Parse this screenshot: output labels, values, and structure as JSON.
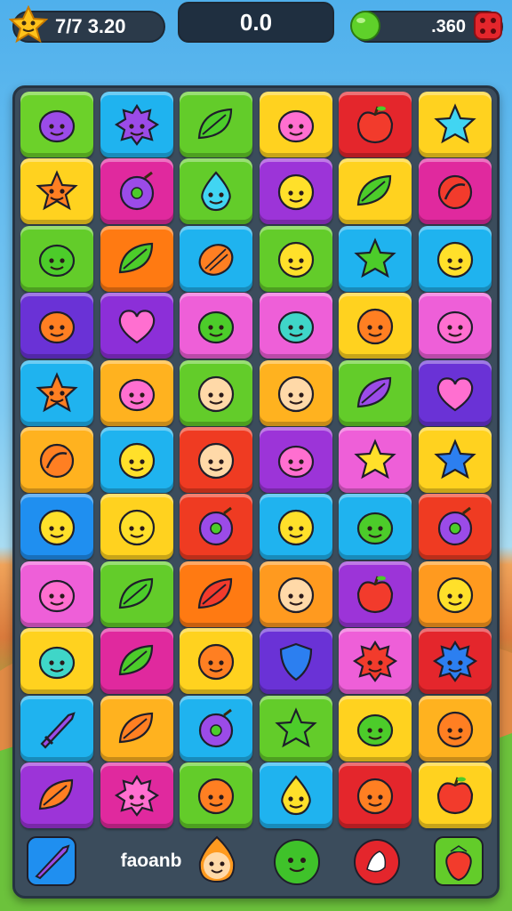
{
  "hud": {
    "left_value": "7/7 3.20",
    "center_value": "0.0",
    "right_value": ".360",
    "left_icon": "star-badge-icon",
    "right_icon_left": "green-orb-icon",
    "right_icon_right": "red-dice-icon"
  },
  "board": {
    "rows": [
      [
        {
          "c": "#6cd12a",
          "i": "blob-purple"
        },
        {
          "c": "#1fb3ef",
          "i": "spiky-purple"
        },
        {
          "c": "#63cc2a",
          "i": "leaf-green"
        },
        {
          "c": "#ffd21f",
          "i": "blob-pink"
        },
        {
          "c": "#e4262c",
          "i": "apple-red"
        },
        {
          "c": "#ffd21f",
          "i": "star-cyan"
        }
      ],
      [
        {
          "c": "#ffd21f",
          "i": "star-orange"
        },
        {
          "c": "#e0299e",
          "i": "plum-purple"
        },
        {
          "c": "#63cc2a",
          "i": "drop-cyan"
        },
        {
          "c": "#9c34d8",
          "i": "face-yellow"
        },
        {
          "c": "#ffd21f",
          "i": "leaf-green"
        },
        {
          "c": "#e0299e",
          "i": "swirl-red"
        }
      ],
      [
        {
          "c": "#63cc2a",
          "i": "blob-green"
        },
        {
          "c": "#ff7a12",
          "i": "leaf-green"
        },
        {
          "c": "#1fb3ef",
          "i": "shell-orange"
        },
        {
          "c": "#63cc2a",
          "i": "face-yellow"
        },
        {
          "c": "#1fb3ef",
          "i": "star-green"
        },
        {
          "c": "#1fb3ef",
          "i": "face-yellow"
        }
      ],
      [
        {
          "c": "#6a32d6",
          "i": "blob-orange"
        },
        {
          "c": "#8c2fd8",
          "i": "heart-pink"
        },
        {
          "c": "#ee5fd8",
          "i": "blob-green"
        },
        {
          "c": "#ee5fd8",
          "i": "blob-teal"
        },
        {
          "c": "#ffd21f",
          "i": "face-orange"
        },
        {
          "c": "#ee5fd8",
          "i": "blob-pink"
        }
      ],
      [
        {
          "c": "#1fb3ef",
          "i": "star-orange"
        },
        {
          "c": "#ffb21f",
          "i": "blob-pink"
        },
        {
          "c": "#63cc2a",
          "i": "face-peach"
        },
        {
          "c": "#ffb21f",
          "i": "face-peach"
        },
        {
          "c": "#63cc2a",
          "i": "leaf-purple"
        },
        {
          "c": "#6a32d6",
          "i": "heart-pink"
        }
      ],
      [
        {
          "c": "#ffb21f",
          "i": "swirl-orange"
        },
        {
          "c": "#1fb3ef",
          "i": "face-yellow"
        },
        {
          "c": "#ef3b22",
          "i": "face-peach"
        },
        {
          "c": "#9c34d8",
          "i": "blob-pink"
        },
        {
          "c": "#ee5fd8",
          "i": "star-yellow"
        },
        {
          "c": "#ffd21f",
          "i": "star-blue"
        }
      ],
      [
        {
          "c": "#1f8ff0",
          "i": "face-yellow"
        },
        {
          "c": "#ffd21f",
          "i": "face-yellow"
        },
        {
          "c": "#ef3b22",
          "i": "plum-purple"
        },
        {
          "c": "#1fb3ef",
          "i": "face-yellow"
        },
        {
          "c": "#1fb3ef",
          "i": "blob-green"
        },
        {
          "c": "#ef3b22",
          "i": "plum-purple"
        }
      ],
      [
        {
          "c": "#ee5fd8",
          "i": "blob-pink"
        },
        {
          "c": "#63cc2a",
          "i": "leaf-green"
        },
        {
          "c": "#ff7a12",
          "i": "leaf-red"
        },
        {
          "c": "#ff9a1f",
          "i": "face-peach"
        },
        {
          "c": "#9c34d8",
          "i": "apple-red"
        },
        {
          "c": "#ff9a1f",
          "i": "face-yellow"
        }
      ],
      [
        {
          "c": "#ffd21f",
          "i": "blob-teal"
        },
        {
          "c": "#e0299e",
          "i": "leaf-green"
        },
        {
          "c": "#ffd21f",
          "i": "face-orange"
        },
        {
          "c": "#6a32d6",
          "i": "shield-blue"
        },
        {
          "c": "#ee5fd8",
          "i": "spiky-red"
        },
        {
          "c": "#e4262c",
          "i": "spiky-blue"
        }
      ],
      [
        {
          "c": "#1fb3ef",
          "i": "sword-purple"
        },
        {
          "c": "#ffb21f",
          "i": "leaf-orange"
        },
        {
          "c": "#1fb3ef",
          "i": "plum-purple"
        },
        {
          "c": "#63cc2a",
          "i": "star-green"
        },
        {
          "c": "#ffd21f",
          "i": "blob-green"
        },
        {
          "c": "#ffb21f",
          "i": "face-orange"
        }
      ],
      [
        {
          "c": "#9c34d8",
          "i": "leaf-orange"
        },
        {
          "c": "#e0299e",
          "i": "spiky-pink"
        },
        {
          "c": "#63cc2a",
          "i": "face-orange"
        },
        {
          "c": "#1fb3ef",
          "i": "drop-yellow"
        },
        {
          "c": "#e4262c",
          "i": "face-orange"
        },
        {
          "c": "#ffd21f",
          "i": "apple-red"
        }
      ]
    ]
  },
  "footer": {
    "label": "faoanb",
    "buttons": [
      {
        "name": "sword-booster-button",
        "icon": "sword-icon",
        "color": "#1f8ff0"
      },
      {
        "name": "fire-face-booster-button",
        "icon": "fire-face-icon",
        "color": "#ff9a1f"
      },
      {
        "name": "green-face-booster-button",
        "icon": "green-face-icon",
        "color": "#3fc22a"
      },
      {
        "name": "red-bird-booster-button",
        "icon": "bird-icon",
        "color": "#e4262c"
      },
      {
        "name": "strawberry-booster-button",
        "icon": "strawberry-icon",
        "color": "#63cc2a"
      }
    ]
  }
}
